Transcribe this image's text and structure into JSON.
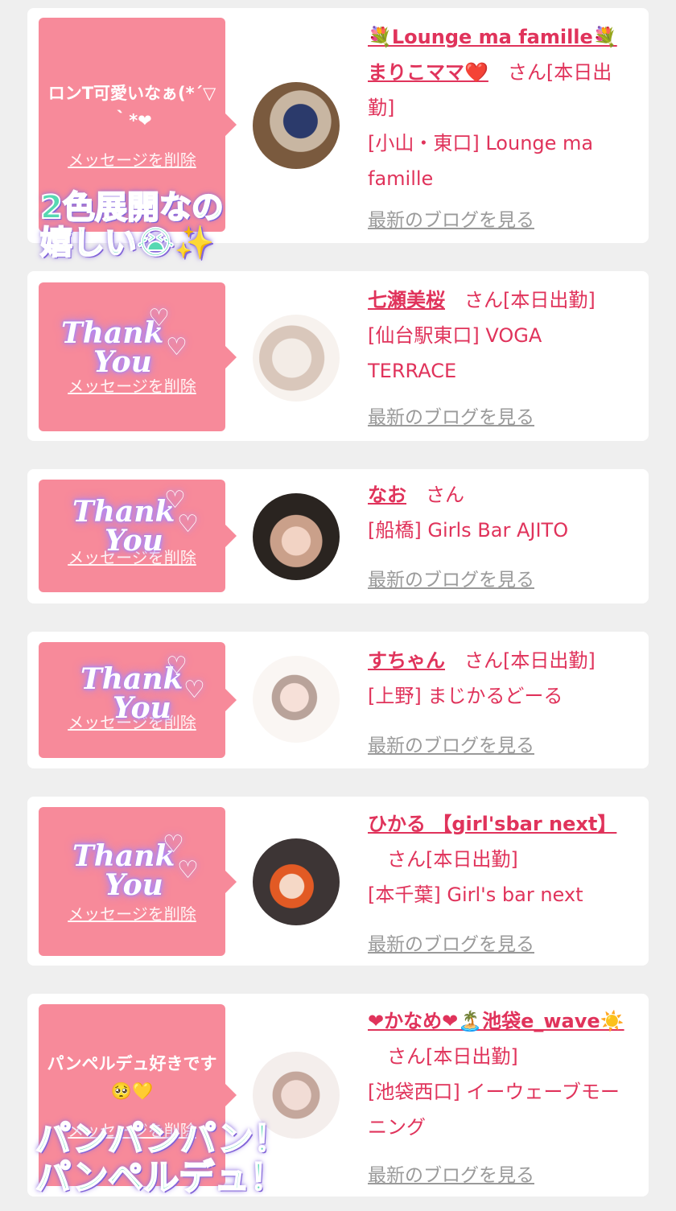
{
  "items": [
    {
      "message": "ロンT可愛いなぁ(*´▽｀*❤",
      "delete": "メッセージを削除",
      "name": "💐Lounge ma famille💐まりこママ❤️",
      "san": "さん",
      "status": "[本日出勤]",
      "shop": "[小山・東口] Lounge ma famille",
      "blog": "最新のブログを見る"
    },
    {
      "message": "",
      "delete": "メッセージを削除",
      "name": "七瀬美桜",
      "san": "さん",
      "status": "[本日出勤]",
      "shop": "[仙台駅東口] VOGA TERRACE",
      "blog": "最新のブログを見る"
    },
    {
      "message": "",
      "delete": "メッセージを削除",
      "name": "なお",
      "san": "さん",
      "status": "",
      "shop": "[船橋] Girls Bar AJITO",
      "blog": "最新のブログを見る"
    },
    {
      "message": "",
      "delete": "メッセージを削除",
      "name": "すちゃん",
      "san": "さん",
      "status": "[本日出勤]",
      "shop": "[上野] まじかるどーる",
      "blog": "最新のブログを見る"
    },
    {
      "message": "",
      "delete": "メッセージを削除",
      "name": "ひかる 【girl'sbar next】",
      "san": "さん",
      "status": "[本日出勤]",
      "shop": "[本千葉] Girl's bar next",
      "blog": "最新のブログを見る"
    },
    {
      "message": "パンペルデュ好きです🥺💛",
      "delete": "メッセージを削除",
      "name": "❤かなめ❤🏝️池袋e_wave☀️",
      "san": "さん",
      "status": "[本日出勤]",
      "shop": "[池袋西口] イーウェーブモーニング",
      "blog": "最新のブログを見る"
    }
  ],
  "overlays": {
    "sticker_top_line1": "2色展開なの",
    "sticker_top_line2": "嬉しい😭✨",
    "thank_word1": "Thank",
    "thank_word2": "You",
    "sticker_bottom_line1": "パンパンパン！",
    "sticker_bottom_line2": "パンペルデュ！"
  },
  "colors": {
    "bubble": "#f78a9a",
    "name": "#e0335b",
    "link_gray": "#9a9a9a",
    "sticker": "#56d8b2"
  }
}
